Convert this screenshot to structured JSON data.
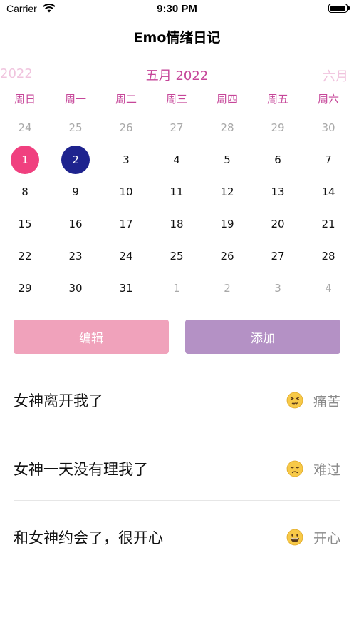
{
  "status_bar": {
    "carrier": "Carrier",
    "time": "9:30 PM",
    "battery_level": 1.0
  },
  "nav": {
    "title": "Emo情绪日记"
  },
  "calendar": {
    "prev_label": "2022",
    "current_label": "五月 2022",
    "next_label": "六月",
    "weekdays": [
      "周日",
      "周一",
      "周二",
      "周三",
      "周四",
      "周五",
      "周六"
    ],
    "weeks": [
      [
        {
          "d": "24",
          "other": true
        },
        {
          "d": "25",
          "other": true
        },
        {
          "d": "26",
          "other": true
        },
        {
          "d": "27",
          "other": true
        },
        {
          "d": "28",
          "other": true
        },
        {
          "d": "29",
          "other": true
        },
        {
          "d": "30",
          "other": true
        }
      ],
      [
        {
          "d": "1",
          "sel": "pink"
        },
        {
          "d": "2",
          "sel": "navy"
        },
        {
          "d": "3"
        },
        {
          "d": "4"
        },
        {
          "d": "5"
        },
        {
          "d": "6"
        },
        {
          "d": "7"
        }
      ],
      [
        {
          "d": "8"
        },
        {
          "d": "9"
        },
        {
          "d": "10"
        },
        {
          "d": "11"
        },
        {
          "d": "12"
        },
        {
          "d": "13"
        },
        {
          "d": "14"
        }
      ],
      [
        {
          "d": "15"
        },
        {
          "d": "16"
        },
        {
          "d": "17"
        },
        {
          "d": "18"
        },
        {
          "d": "19"
        },
        {
          "d": "20"
        },
        {
          "d": "21"
        }
      ],
      [
        {
          "d": "22"
        },
        {
          "d": "23"
        },
        {
          "d": "24"
        },
        {
          "d": "25"
        },
        {
          "d": "26"
        },
        {
          "d": "27"
        },
        {
          "d": "28"
        }
      ],
      [
        {
          "d": "29"
        },
        {
          "d": "30"
        },
        {
          "d": "31"
        },
        {
          "d": "1",
          "other": true
        },
        {
          "d": "2",
          "other": true
        },
        {
          "d": "3",
          "other": true
        },
        {
          "d": "4",
          "other": true
        }
      ]
    ]
  },
  "actions": {
    "edit_label": "编辑",
    "add_label": "添加"
  },
  "entries": [
    {
      "text": "女神离开我了",
      "emoji": "persevering-face-icon",
      "mood": "痛苦"
    },
    {
      "text": "女神一天没有理我了",
      "emoji": "disappointed-face-icon",
      "mood": "难过"
    },
    {
      "text": "和女神约会了，很开心",
      "emoji": "grinning-face-icon",
      "mood": "开心"
    }
  ],
  "colors": {
    "accent": "#c64699",
    "selected_primary": "#f0407f",
    "selected_secondary": "#1e238e",
    "edit_button": "#f0a2bb",
    "add_button": "#b491c5"
  }
}
